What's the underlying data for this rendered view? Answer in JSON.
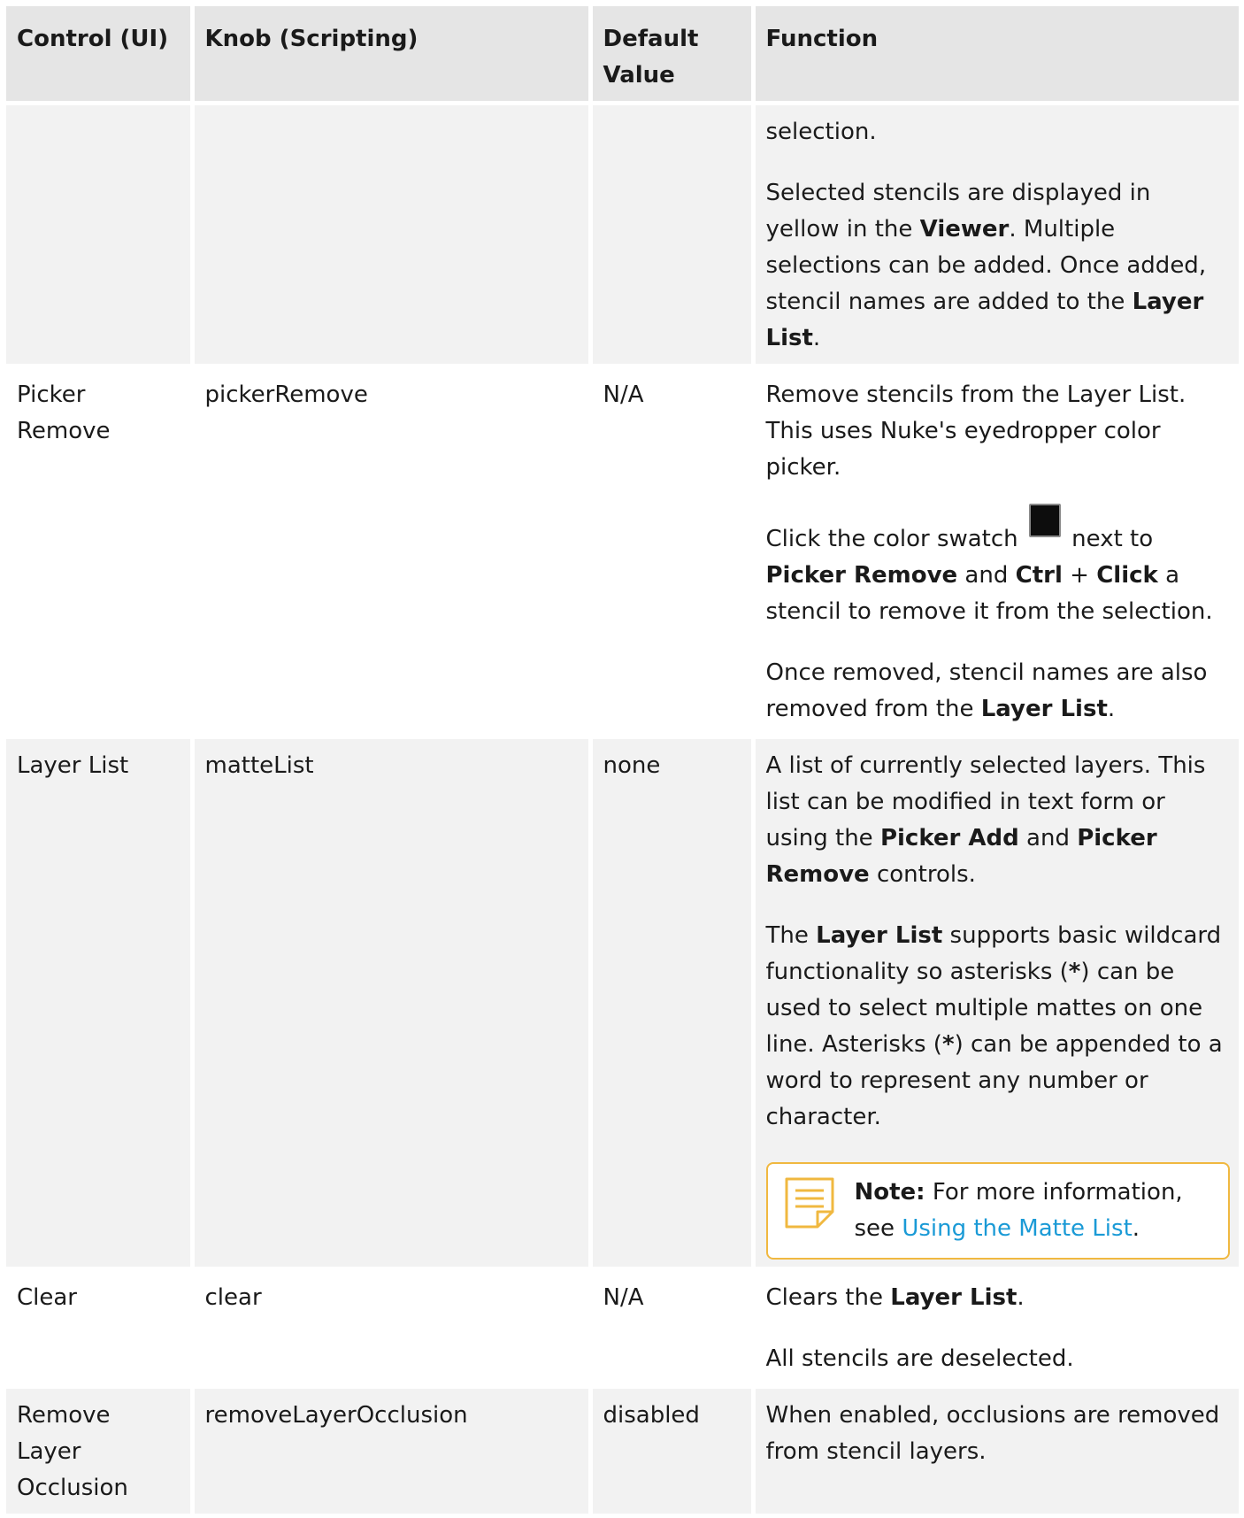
{
  "headers": {
    "control": "Control (UI)",
    "knob": "Knob (Scripting)",
    "default_line1": "Default",
    "default_line2": "Value",
    "function": "Function"
  },
  "row1": {
    "control": "",
    "knob": "",
    "default": "",
    "p1": "selection.",
    "p2_a": "Selected stencils are displayed in yellow in the ",
    "p2_b1": "Viewer",
    "p2_c": ". Multiple selections can be added. Once added, stencil names are added to the ",
    "p2_b2": "Layer List",
    "p2_d": "."
  },
  "row2": {
    "control": "Picker Remove",
    "knob": "pickerRemove",
    "default": "N/A",
    "p1": "Remove stencils from the Layer List. This uses Nuke's eyedropper color picker.",
    "p2_a": "Click the color swatch ",
    "p2_b": " next to ",
    "p2_b1": "Picker Remove",
    "p2_c": " and ",
    "p2_b2": "Ctrl",
    "p2_d": " + ",
    "p2_b3": "Click",
    "p2_e": " a stencil to remove it from the selection.",
    "p3_a": "Once removed, stencil names are also removed from the ",
    "p3_b": "Layer List",
    "p3_c": "."
  },
  "row3": {
    "control": "Layer List",
    "knob": "matteList",
    "default": "none",
    "p1_a": "A list of currently selected layers. This list can be modified in text form or using the ",
    "p1_b1": "Picker Add",
    "p1_c": " and ",
    "p1_b2": "Picker Remove",
    "p1_d": " controls.",
    "p2_a": "The ",
    "p2_b1": "Layer List",
    "p2_c": " supports basic wildcard functionality so asterisks (",
    "p2_b2": "*",
    "p2_d": ") can be used to select multiple mattes on one line. Asterisks (",
    "p2_b3": "*",
    "p2_e": ") can be appended to a word to represent any number or character.",
    "note_label": "Note:",
    "note_text": "  For more information, see ",
    "note_link": "Using the Matte List",
    "note_end": "."
  },
  "row4": {
    "control": "Clear",
    "knob": "clear",
    "default": "N/A",
    "p1_a": "Clears the ",
    "p1_b": "Layer List",
    "p1_c": ".",
    "p2": "All stencils are deselected."
  },
  "row5": {
    "control": "Remove Layer Occlusion",
    "knob": "removeLayerOcclusion",
    "default": "disabled",
    "p1": "When enabled, occlusions are removed from stencil layers."
  },
  "colors": {
    "header_bg": "#e5e5e5",
    "row_alt_bg": "#f2f2f2",
    "note_border": "#f0b840",
    "link": "#1a9ad6"
  }
}
